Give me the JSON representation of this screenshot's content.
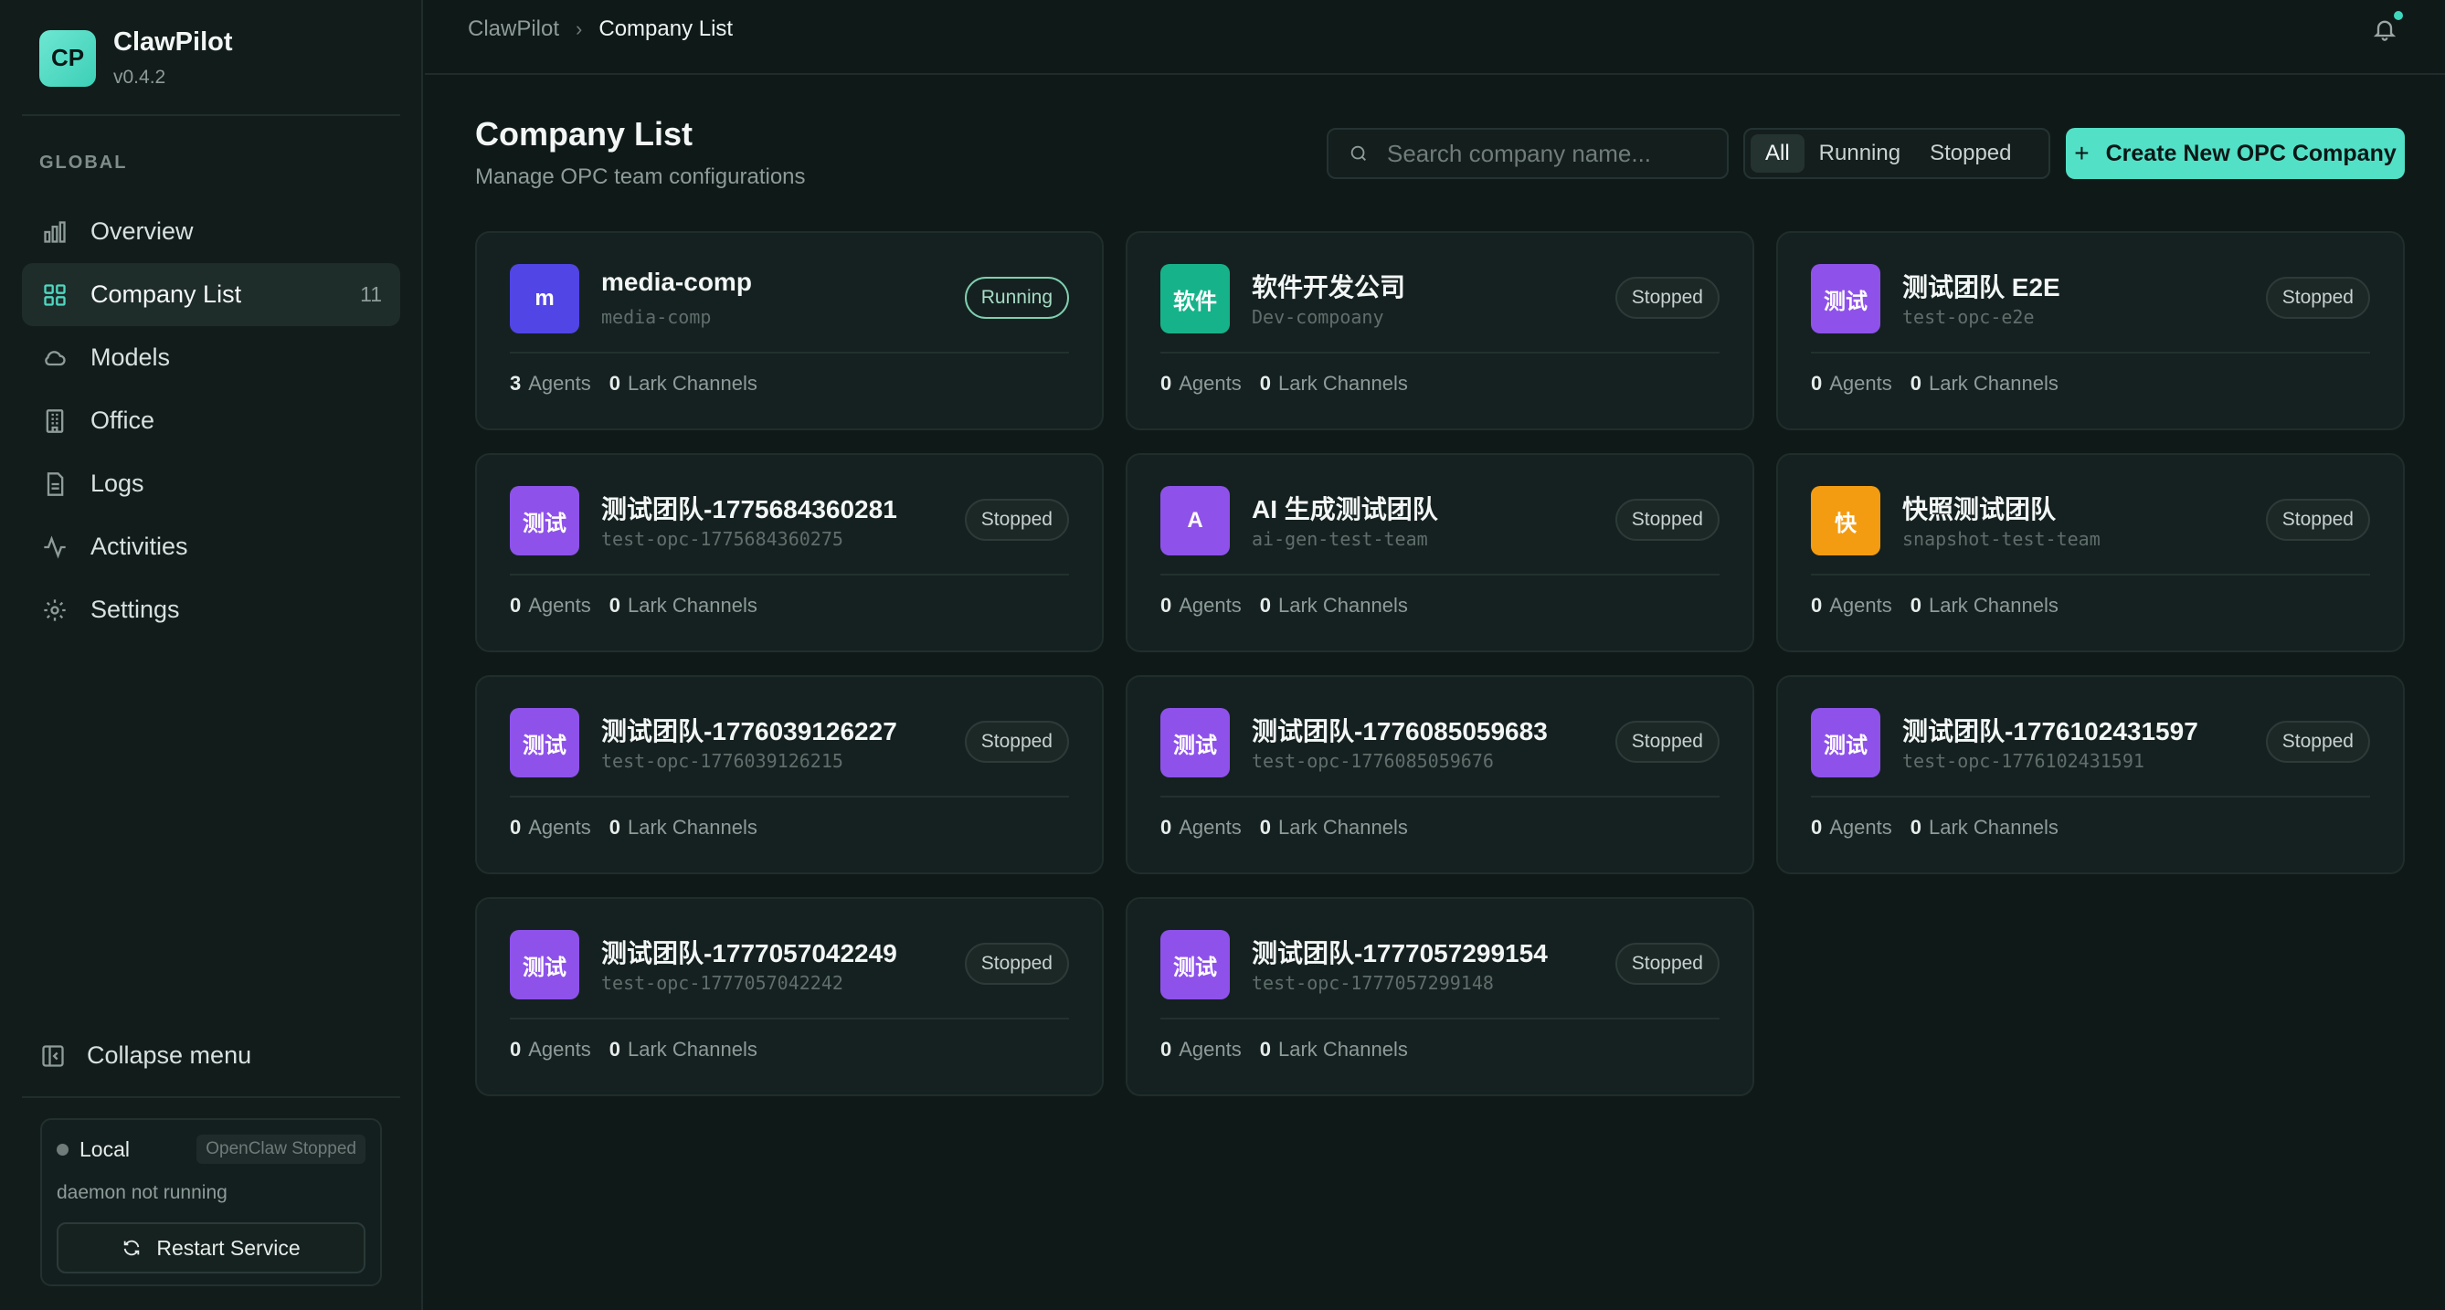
{
  "brand": {
    "logo": "CP",
    "name": "ClawPilot",
    "version": "v0.4.2"
  },
  "sidebar": {
    "section_label": "GLOBAL",
    "items": [
      {
        "label": "Overview",
        "icon": "bar-chart-icon",
        "count": ""
      },
      {
        "label": "Company List",
        "icon": "grid-icon",
        "count": "11"
      },
      {
        "label": "Models",
        "icon": "cloud-icon",
        "count": ""
      },
      {
        "label": "Office",
        "icon": "building-icon",
        "count": ""
      },
      {
        "label": "Logs",
        "icon": "file-icon",
        "count": ""
      },
      {
        "label": "Activities",
        "icon": "activity-icon",
        "count": ""
      },
      {
        "label": "Settings",
        "icon": "gear-icon",
        "count": ""
      }
    ],
    "collapse_label": "Collapse menu",
    "status": {
      "mode": "Local",
      "tag": "OpenClaw Stopped",
      "message": "daemon not running",
      "restart_label": "Restart Service"
    }
  },
  "header": {
    "breadcrumb_root": "ClawPilot",
    "breadcrumb_sep": "›",
    "breadcrumb_current": "Company List"
  },
  "main": {
    "title": "Company List",
    "subtitle": "Manage OPC team configurations",
    "search_placeholder": "Search company name...",
    "filters": [
      "All",
      "Running",
      "Stopped"
    ],
    "active_filter": "All",
    "create_label": "Create New OPC Company",
    "agents_label": "Agents",
    "channels_label": "Lark Channels"
  },
  "companies": [
    {
      "avatar": "m",
      "avatar_color": "#5145e5",
      "name": "media-comp",
      "slug": "media-comp",
      "status": "Running",
      "agents": "3",
      "channels": "0"
    },
    {
      "avatar": "软件",
      "avatar_color": "#16b38a",
      "name": "软件开发公司",
      "slug": "Dev-compoany",
      "status": "Stopped",
      "agents": "0",
      "channels": "0"
    },
    {
      "avatar": "测试",
      "avatar_color": "#8e52ea",
      "name": "测试团队 E2E",
      "slug": "test-opc-e2e",
      "status": "Stopped",
      "agents": "0",
      "channels": "0"
    },
    {
      "avatar": "测试",
      "avatar_color": "#8e52ea",
      "name": "测试团队-1775684360281",
      "slug": "test-opc-1775684360275",
      "status": "Stopped",
      "agents": "0",
      "channels": "0"
    },
    {
      "avatar": "A",
      "avatar_color": "#8e52ea",
      "name": "AI 生成测试团队",
      "slug": "ai-gen-test-team",
      "status": "Stopped",
      "agents": "0",
      "channels": "0"
    },
    {
      "avatar": "快",
      "avatar_color": "#f39c12",
      "name": "快照测试团队",
      "slug": "snapshot-test-team",
      "status": "Stopped",
      "agents": "0",
      "channels": "0"
    },
    {
      "avatar": "测试",
      "avatar_color": "#8e52ea",
      "name": "测试团队-1776039126227",
      "slug": "test-opc-1776039126215",
      "status": "Stopped",
      "agents": "0",
      "channels": "0"
    },
    {
      "avatar": "测试",
      "avatar_color": "#8e52ea",
      "name": "测试团队-1776085059683",
      "slug": "test-opc-1776085059676",
      "status": "Stopped",
      "agents": "0",
      "channels": "0"
    },
    {
      "avatar": "测试",
      "avatar_color": "#8e52ea",
      "name": "测试团队-1776102431597",
      "slug": "test-opc-1776102431591",
      "status": "Stopped",
      "agents": "0",
      "channels": "0"
    },
    {
      "avatar": "测试",
      "avatar_color": "#8e52ea",
      "name": "测试团队-1777057042249",
      "slug": "test-opc-1777057042242",
      "status": "Stopped",
      "agents": "0",
      "channels": "0"
    },
    {
      "avatar": "测试",
      "avatar_color": "#8e52ea",
      "name": "测试团队-1777057299154",
      "slug": "test-opc-1777057299148",
      "status": "Stopped",
      "agents": "0",
      "channels": "0"
    }
  ]
}
